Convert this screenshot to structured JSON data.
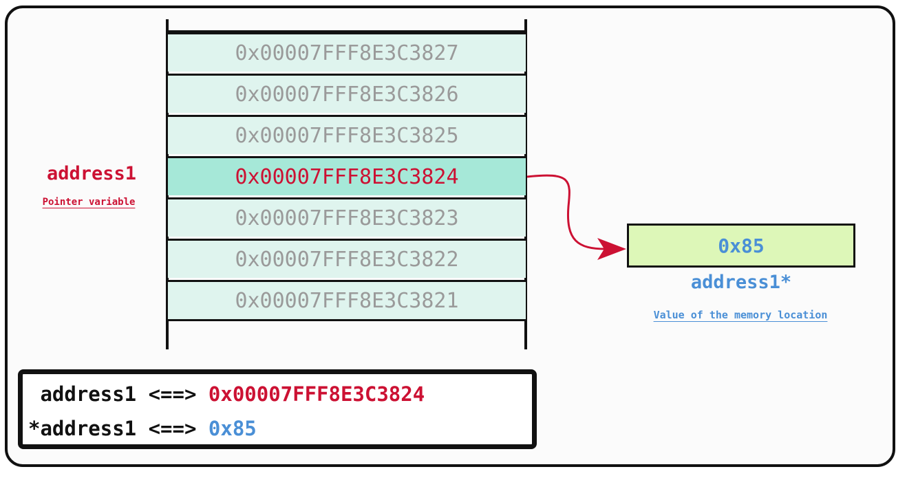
{
  "memory": {
    "cells": [
      {
        "address": "0x00007FFF8E3C3827",
        "active": false
      },
      {
        "address": "0x00007FFF8E3C3826",
        "active": false
      },
      {
        "address": "0x00007FFF8E3C3825",
        "active": false
      },
      {
        "address": "0x00007FFF8E3C3824",
        "active": true
      },
      {
        "address": "0x00007FFF8E3C3823",
        "active": false
      },
      {
        "address": "0x00007FFF8E3C3822",
        "active": false
      },
      {
        "address": "0x00007FFF8E3C3821",
        "active": false
      }
    ]
  },
  "pointer": {
    "name": "address1",
    "description": "Pointer variable"
  },
  "target": {
    "value": "0x85",
    "name": "address1*",
    "description": "Value of the memory location"
  },
  "summary": {
    "line1_lhs": " address1 <==> ",
    "line1_rhs": "0x00007FFF8E3C3824",
    "line2_lhs": "*address1 <==> ",
    "line2_rhs": "0x85"
  },
  "colors": {
    "pointer_red": "#cc1133",
    "value_blue": "#4a8fd6",
    "cell_bg": "#dff4ee",
    "cell_active_bg": "#a6e8d8",
    "value_box_bg": "#ddf7b8"
  }
}
